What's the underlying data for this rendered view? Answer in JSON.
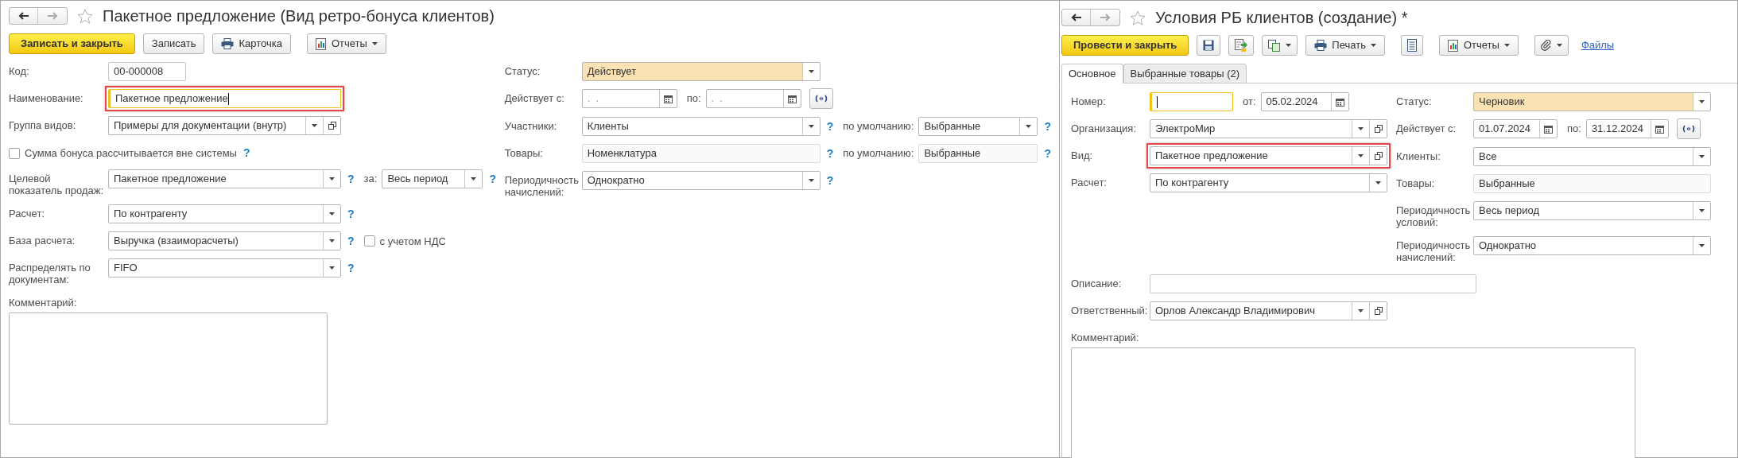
{
  "windows": [
    {
      "title": "Пакетное предложение (Вид ретро-бонуса клиентов)",
      "nav": {
        "back_disabled": false,
        "forward_disabled": true
      },
      "toolbar": [
        {
          "kind": "primary",
          "label": "Записать и закрыть"
        },
        {
          "kind": "button",
          "label": "Записать"
        },
        {
          "kind": "print-button",
          "label": "Карточка"
        },
        {
          "kind": "report-button",
          "label": "Отчеты",
          "dropdown": true
        }
      ],
      "columns": [
        {
          "rows": [
            {
              "kind": "field",
              "label": "Код:",
              "controls": [
                {
                  "kind": "text",
                  "value": "00-000008"
                }
              ]
            },
            {
              "kind": "field",
              "label": "Наименование:",
              "controls": [
                {
                  "kind": "text",
                  "value": "Пакетное предложение",
                  "focused": true,
                  "highlighted": true
                }
              ]
            },
            {
              "kind": "field",
              "label": "Группа видов:",
              "controls": [
                {
                  "kind": "select",
                  "value": "Примеры для документации (внутр)",
                  "open_button": true
                }
              ]
            },
            {
              "kind": "option",
              "controls": [
                {
                  "kind": "checkbox",
                  "label": "Сумма бонуса рассчитывается вне системы",
                  "checked": false
                },
                {
                  "kind": "help",
                  "text": "?"
                }
              ]
            },
            {
              "kind": "field",
              "label": "Целевой показатель продаж:",
              "controls": [
                {
                  "kind": "select",
                  "value": "Пакетное предложение"
                },
                {
                  "kind": "help",
                  "text": "?"
                },
                {
                  "kind": "inline-label",
                  "text": "за:"
                },
                {
                  "kind": "select",
                  "value": "Весь период"
                },
                {
                  "kind": "help",
                  "text": "?"
                }
              ]
            },
            {
              "kind": "field",
              "label": "Расчет:",
              "controls": [
                {
                  "kind": "select",
                  "value": "По контрагенту"
                },
                {
                  "kind": "help",
                  "text": "?"
                }
              ]
            },
            {
              "kind": "field",
              "label": "База расчета:",
              "controls": [
                {
                  "kind": "select",
                  "value": "Выручка (взаиморасчеты)"
                },
                {
                  "kind": "help",
                  "text": "?"
                },
                {
                  "kind": "checkbox",
                  "label": "с учетом НДС",
                  "checked": false
                }
              ]
            },
            {
              "kind": "field",
              "label": "Распределять по документам:",
              "controls": [
                {
                  "kind": "select",
                  "value": "FIFO"
                },
                {
                  "kind": "help",
                  "text": "?"
                }
              ]
            },
            {
              "kind": "textarea",
              "label": "Комментарий:"
            }
          ]
        },
        {
          "rows": [
            {
              "kind": "field",
              "label": "Статус:",
              "controls": [
                {
                  "kind": "status-select",
                  "value": "Действует"
                }
              ]
            },
            {
              "kind": "field",
              "label": "Действует с:",
              "controls": [
                {
                  "kind": "date",
                  "placeholder": ".  ."
                },
                {
                  "kind": "inline-label",
                  "text": "по:"
                },
                {
                  "kind": "date",
                  "placeholder": ".  ."
                },
                {
                  "kind": "period-button"
                }
              ]
            },
            {
              "kind": "field",
              "label": "Участники:",
              "controls": [
                {
                  "kind": "select",
                  "value": "Клиенты"
                },
                {
                  "kind": "help",
                  "text": "?"
                },
                {
                  "kind": "inline-label",
                  "text": "по умолчанию:"
                },
                {
                  "kind": "select",
                  "value": "Выбранные"
                },
                {
                  "kind": "help",
                  "text": "?"
                }
              ]
            },
            {
              "kind": "field",
              "label": "Товары:",
              "controls": [
                {
                  "kind": "readonly",
                  "value": "Номенклатура"
                },
                {
                  "kind": "help",
                  "text": "?"
                },
                {
                  "kind": "inline-label",
                  "text": "по умолчанию:"
                },
                {
                  "kind": "readonly",
                  "value": "Выбранные"
                },
                {
                  "kind": "help",
                  "text": "?"
                }
              ]
            },
            {
              "kind": "field",
              "label": "Периодичность начислений:",
              "controls": [
                {
                  "kind": "select",
                  "value": "Однократно"
                },
                {
                  "kind": "help",
                  "text": "?"
                }
              ]
            }
          ]
        }
      ]
    },
    {
      "title": "Условия РБ клиентов (создание) *",
      "nav": {
        "back_disabled": false,
        "forward_disabled": true
      },
      "toolbar": [
        {
          "kind": "primary",
          "label": "Провести и закрыть"
        },
        {
          "kind": "save-button"
        },
        {
          "kind": "post-button"
        },
        {
          "kind": "copy-button",
          "dropdown": true
        },
        {
          "kind": "print-button",
          "label": "Печать",
          "dropdown": true
        },
        {
          "kind": "list-button"
        },
        {
          "kind": "report-button",
          "label": "Отчеты",
          "dropdown": true
        },
        {
          "kind": "attach-button",
          "dropdown": true
        },
        {
          "kind": "link",
          "label": "Файлы"
        }
      ],
      "tabs": [
        {
          "label": "Основное",
          "selected": true
        },
        {
          "label": "Выбранные товары (2)",
          "selected": false
        }
      ],
      "columns": [
        {
          "rows": [
            {
              "kind": "field",
              "label": "Номер:",
              "controls": [
                {
                  "kind": "text",
                  "focused": true
                },
                {
                  "kind": "inline-label",
                  "text": "от:"
                },
                {
                  "kind": "date",
                  "value": "05.02.2024"
                }
              ]
            },
            {
              "kind": "field",
              "label": "Организация:",
              "controls": [
                {
                  "kind": "select",
                  "value": "ЭлектроМир",
                  "open_button": true
                }
              ]
            },
            {
              "kind": "field",
              "label": "Вид:",
              "controls": [
                {
                  "kind": "select",
                  "value": "Пакетное предложение",
                  "open_button": true,
                  "highlighted": true
                }
              ]
            },
            {
              "kind": "field",
              "label": "Расчет:",
              "controls": [
                {
                  "kind": "select",
                  "value": "По контрагенту"
                }
              ]
            }
          ]
        },
        {
          "rows": [
            {
              "kind": "field",
              "label": "Статус:",
              "controls": [
                {
                  "kind": "status-select",
                  "value": "Черновик"
                }
              ]
            },
            {
              "kind": "field",
              "label": "Действует с:",
              "controls": [
                {
                  "kind": "date",
                  "value": "01.07.2024"
                },
                {
                  "kind": "inline-label",
                  "text": "по:"
                },
                {
                  "kind": "date",
                  "value": "31.12.2024"
                },
                {
                  "kind": "period-button"
                }
              ]
            },
            {
              "kind": "field",
              "label": "Клиенты:",
              "controls": [
                {
                  "kind": "select",
                  "value": "Все"
                }
              ]
            },
            {
              "kind": "field",
              "label": "Товары:",
              "controls": [
                {
                  "kind": "readonly",
                  "value": "Выбранные"
                }
              ]
            },
            {
              "kind": "field",
              "label": "Периодичность условий:",
              "controls": [
                {
                  "kind": "select",
                  "value": "Весь период"
                }
              ]
            },
            {
              "kind": "field",
              "label": "Периодичность начислений:",
              "controls": [
                {
                  "kind": "select",
                  "value": "Однократно"
                }
              ]
            }
          ]
        }
      ],
      "bottom_rows": [
        {
          "kind": "field",
          "label": "Описание:",
          "controls": [
            {
              "kind": "text"
            }
          ]
        },
        {
          "kind": "field",
          "label": "Ответственный:",
          "controls": [
            {
              "kind": "select",
              "value": "Орлов Александр Владимирович",
              "open_button": true
            }
          ]
        },
        {
          "kind": "textarea",
          "label": "Комментарий:"
        }
      ]
    }
  ]
}
